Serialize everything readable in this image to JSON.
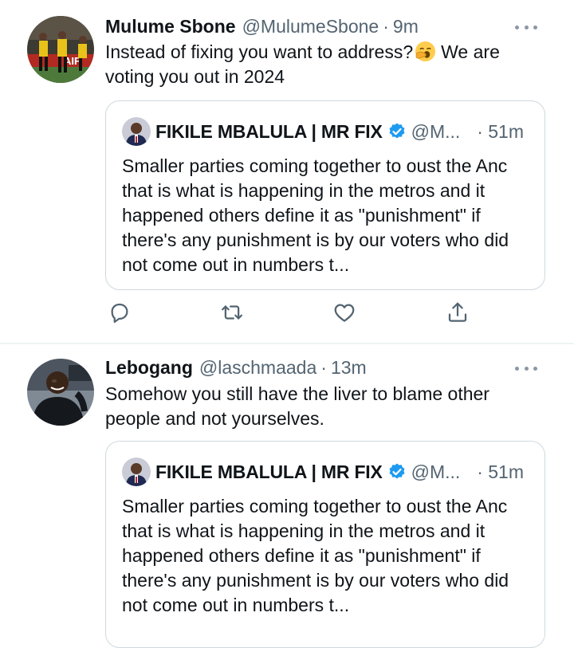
{
  "tweets": [
    {
      "author_name": "Mulume Sbone",
      "handle": "@MulumeSbone",
      "separator": "·",
      "time": "9m",
      "text_before_emoji": "Instead of fixing you want to address?",
      "emoji": "yawning-face",
      "text_after_emoji": "We are voting you out in 2024",
      "quote": {
        "author_name": "FIKILE MBALULA | MR FIX",
        "handle": "@M...",
        "time": "· 51m",
        "text": "Smaller parties coming together to oust the Anc that is what is happening in the metros and it happened others define it as \"punishment\" if there's any punishment is by our voters who did not come out in numbers t..."
      }
    },
    {
      "author_name": "Lebogang",
      "handle": "@laschmaada",
      "separator": "·",
      "time": "13m",
      "text": "Somehow you still have the liver to blame other people and not yourselves.",
      "quote": {
        "author_name": "FIKILE MBALULA | MR FIX",
        "handle": "@M...",
        "time": "· 51m",
        "text": "Smaller parties coming together to oust the Anc that is what is happening in the metros and it happened others define it as \"punishment\" if there's any punishment is by our voters who did not come out in numbers t..."
      }
    }
  ],
  "icons": {
    "reply": "reply-icon",
    "retweet": "retweet-icon",
    "like": "like-icon",
    "share": "share-icon",
    "more": "more-icon",
    "verified": "verified-icon"
  },
  "colors": {
    "text": "#0f1419",
    "secondary": "#536471",
    "verified": "#1d9bf0",
    "border": "#cfd9de"
  }
}
